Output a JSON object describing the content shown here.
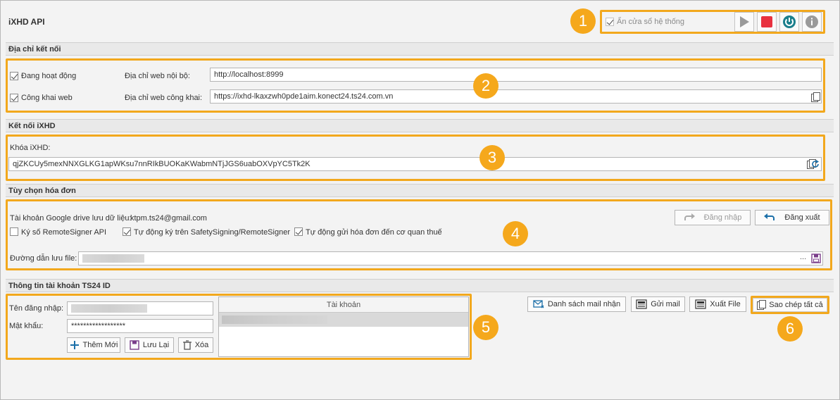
{
  "app": {
    "title": "iXHD API"
  },
  "toolbar": {
    "hide_window_label": "Ẩn cửa sổ hệ thống",
    "hide_window_checked": true
  },
  "badges": [
    "1",
    "2",
    "3",
    "4",
    "5",
    "6"
  ],
  "connection": {
    "section_title": "Địa chỉ kết nối",
    "active_label": "Đang hoạt động",
    "active_checked": true,
    "public_label": "Công khai web",
    "public_checked": true,
    "local_url_label": "Địa chỉ web nội bộ:",
    "local_url_value": "http://localhost:8999",
    "public_url_label": "Địa chỉ web công khai:",
    "public_url_value": "https://ixhd-lkaxzwh0pde1aim.konect24.ts24.com.vn"
  },
  "ixhd": {
    "section_title": "Kết nối iXHD",
    "key_label": "Khóa iXHD:",
    "key_value": "qjZKCUy5mexNNXGLKG1apWKsu7nnRIkBUOKaKWabmNTjJGS6uabOXVpYC5Tk2K"
  },
  "invoice": {
    "section_title": "Tùy chọn hóa đơn",
    "google_label": "Tài khoản Google drive lưu dữ liệu:",
    "google_value": "ktpm.ts24@gmail.com",
    "login_label": "Đăng nhập",
    "logout_label": "Đăng xuất",
    "remote_signer_label": "Ký số RemoteSigner API",
    "remote_signer_checked": false,
    "auto_sign_label": "Tự động ký trên SafetySigning/RemoteSigner",
    "auto_sign_checked": true,
    "auto_send_label": "Tự động gửi hóa đơn đến cơ quan thuế",
    "auto_send_checked": true,
    "path_label": "Đường dẫn lưu file:",
    "path_more": "..."
  },
  "account": {
    "section_title": "Thông tin tài khoản TS24 ID",
    "username_label": "Tên đăng nhập:",
    "password_label": "Mật khẩu:",
    "password_value": "******************",
    "add_label": "Thêm Mới",
    "save_label": "Lưu Lại",
    "delete_label": "Xóa",
    "grid_header": "Tài khoản",
    "mail_list_label": "Danh sách mail nhận",
    "send_mail_label": "Gửi mail",
    "export_label": "Xuất File",
    "copy_all_label": "Sao chép tất cả"
  },
  "colors": {
    "accent": "#f2a81d",
    "stop_red": "#e8313f",
    "refresh_teal": "#1b7f8c"
  }
}
